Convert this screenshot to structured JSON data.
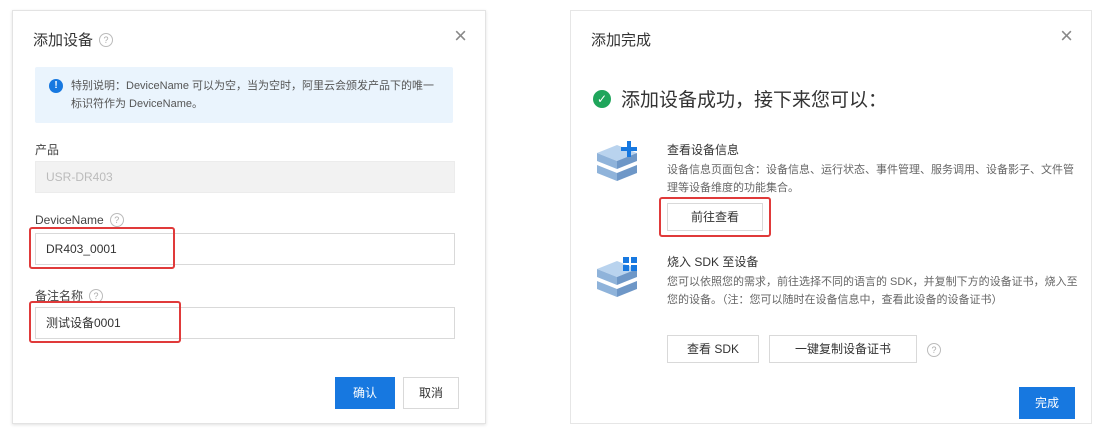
{
  "add_dialog": {
    "title": "添加设备",
    "info_text": "特别说明：DeviceName 可以为空，当为空时，阿里云会颁发产品下的唯一标识符作为 DeviceName。",
    "product_label": "产品",
    "product_value": "USR-DR403",
    "device_name_label": "DeviceName",
    "device_name_value": "DR403_0001",
    "remark_label": "备注名称",
    "remark_value": "测试设备0001",
    "confirm_label": "确认",
    "cancel_label": "取消"
  },
  "done_dialog": {
    "title": "添加完成",
    "success_text": "添加设备成功，接下来您可以：",
    "view_title": "查看设备信息",
    "view_desc": "设备信息页面包含：设备信息、运行状态、事件管理、服务调用、设备影子、文件管理等设备维度的功能集合。",
    "goto_label": "前往查看",
    "sdk_title": "烧入 SDK 至设备",
    "sdk_desc": "您可以依照您的需求，前往选择不同的语言的 SDK，并复制下方的设备证书，烧入至您的设备。（注：您可以随时在设备信息中，查看此设备的设备证书）",
    "view_sdk_label": "查看 SDK",
    "copy_cert_label": "一键复制设备证书",
    "finish_label": "完成"
  },
  "colors": {
    "primary": "#1778e0",
    "highlight": "#e03a3a",
    "success": "#1fa55b",
    "info_bg": "#eaf4fd"
  },
  "icons": [
    "help-icon",
    "close-icon",
    "info-icon",
    "check-circle-icon",
    "server-add-icon",
    "server-sdk-icon"
  ]
}
